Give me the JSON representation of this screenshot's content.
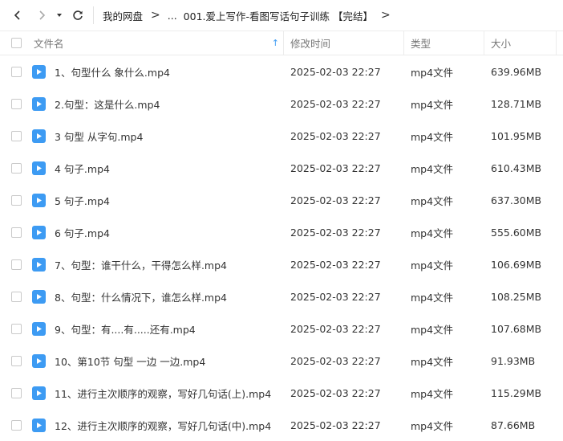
{
  "toolbar": {
    "back_icon": "chevron-left-icon",
    "forward_icon": "chevron-right-icon",
    "history_icon": "caret-down-icon",
    "refresh_icon": "refresh-icon"
  },
  "breadcrumb": {
    "root": "我的网盘",
    "ellipsis": "...",
    "current": "001.爱上写作-看图写话句子训练 【完结】",
    "separator": ">"
  },
  "columns": {
    "name": "文件名",
    "modified": "修改时间",
    "type": "类型",
    "size": "大小",
    "sort_indicator": "↑"
  },
  "files": [
    {
      "name": "1、句型什么 象什么.mp4",
      "modified": "2025-02-03 22:27",
      "type": "mp4文件",
      "size": "639.96MB"
    },
    {
      "name": "2.句型：这是什么.mp4",
      "modified": "2025-02-03 22:27",
      "type": "mp4文件",
      "size": "128.71MB"
    },
    {
      "name": "3 句型 从字句.mp4",
      "modified": "2025-02-03 22:27",
      "type": "mp4文件",
      "size": "101.95MB"
    },
    {
      "name": "4 句子.mp4",
      "modified": "2025-02-03 22:27",
      "type": "mp4文件",
      "size": "610.43MB"
    },
    {
      "name": "5 句子.mp4",
      "modified": "2025-02-03 22:27",
      "type": "mp4文件",
      "size": "637.30MB"
    },
    {
      "name": "6 句子.mp4",
      "modified": "2025-02-03 22:27",
      "type": "mp4文件",
      "size": "555.60MB"
    },
    {
      "name": "7、句型：谁干什么，干得怎么样.mp4",
      "modified": "2025-02-03 22:27",
      "type": "mp4文件",
      "size": "106.69MB"
    },
    {
      "name": "8、句型：什么情况下，谁怎么样.mp4",
      "modified": "2025-02-03 22:27",
      "type": "mp4文件",
      "size": "108.25MB"
    },
    {
      "name": "9、句型：有....有.....还有.mp4",
      "modified": "2025-02-03 22:27",
      "type": "mp4文件",
      "size": "107.68MB"
    },
    {
      "name": "10、第10节 句型 一边  一边.mp4",
      "modified": "2025-02-03 22:27",
      "type": "mp4文件",
      "size": "91.93MB"
    },
    {
      "name": "11、进行主次顺序的观察，写好几句话(上).mp4",
      "modified": "2025-02-03 22:27",
      "type": "mp4文件",
      "size": "115.29MB"
    },
    {
      "name": "12、进行主次顺序的观察，写好几句话(中).mp4",
      "modified": "2025-02-03 22:27",
      "type": "mp4文件",
      "size": "87.66MB"
    }
  ],
  "colors": {
    "accent": "#3d9bf3",
    "text": "#333333",
    "header_text": "#777777"
  }
}
